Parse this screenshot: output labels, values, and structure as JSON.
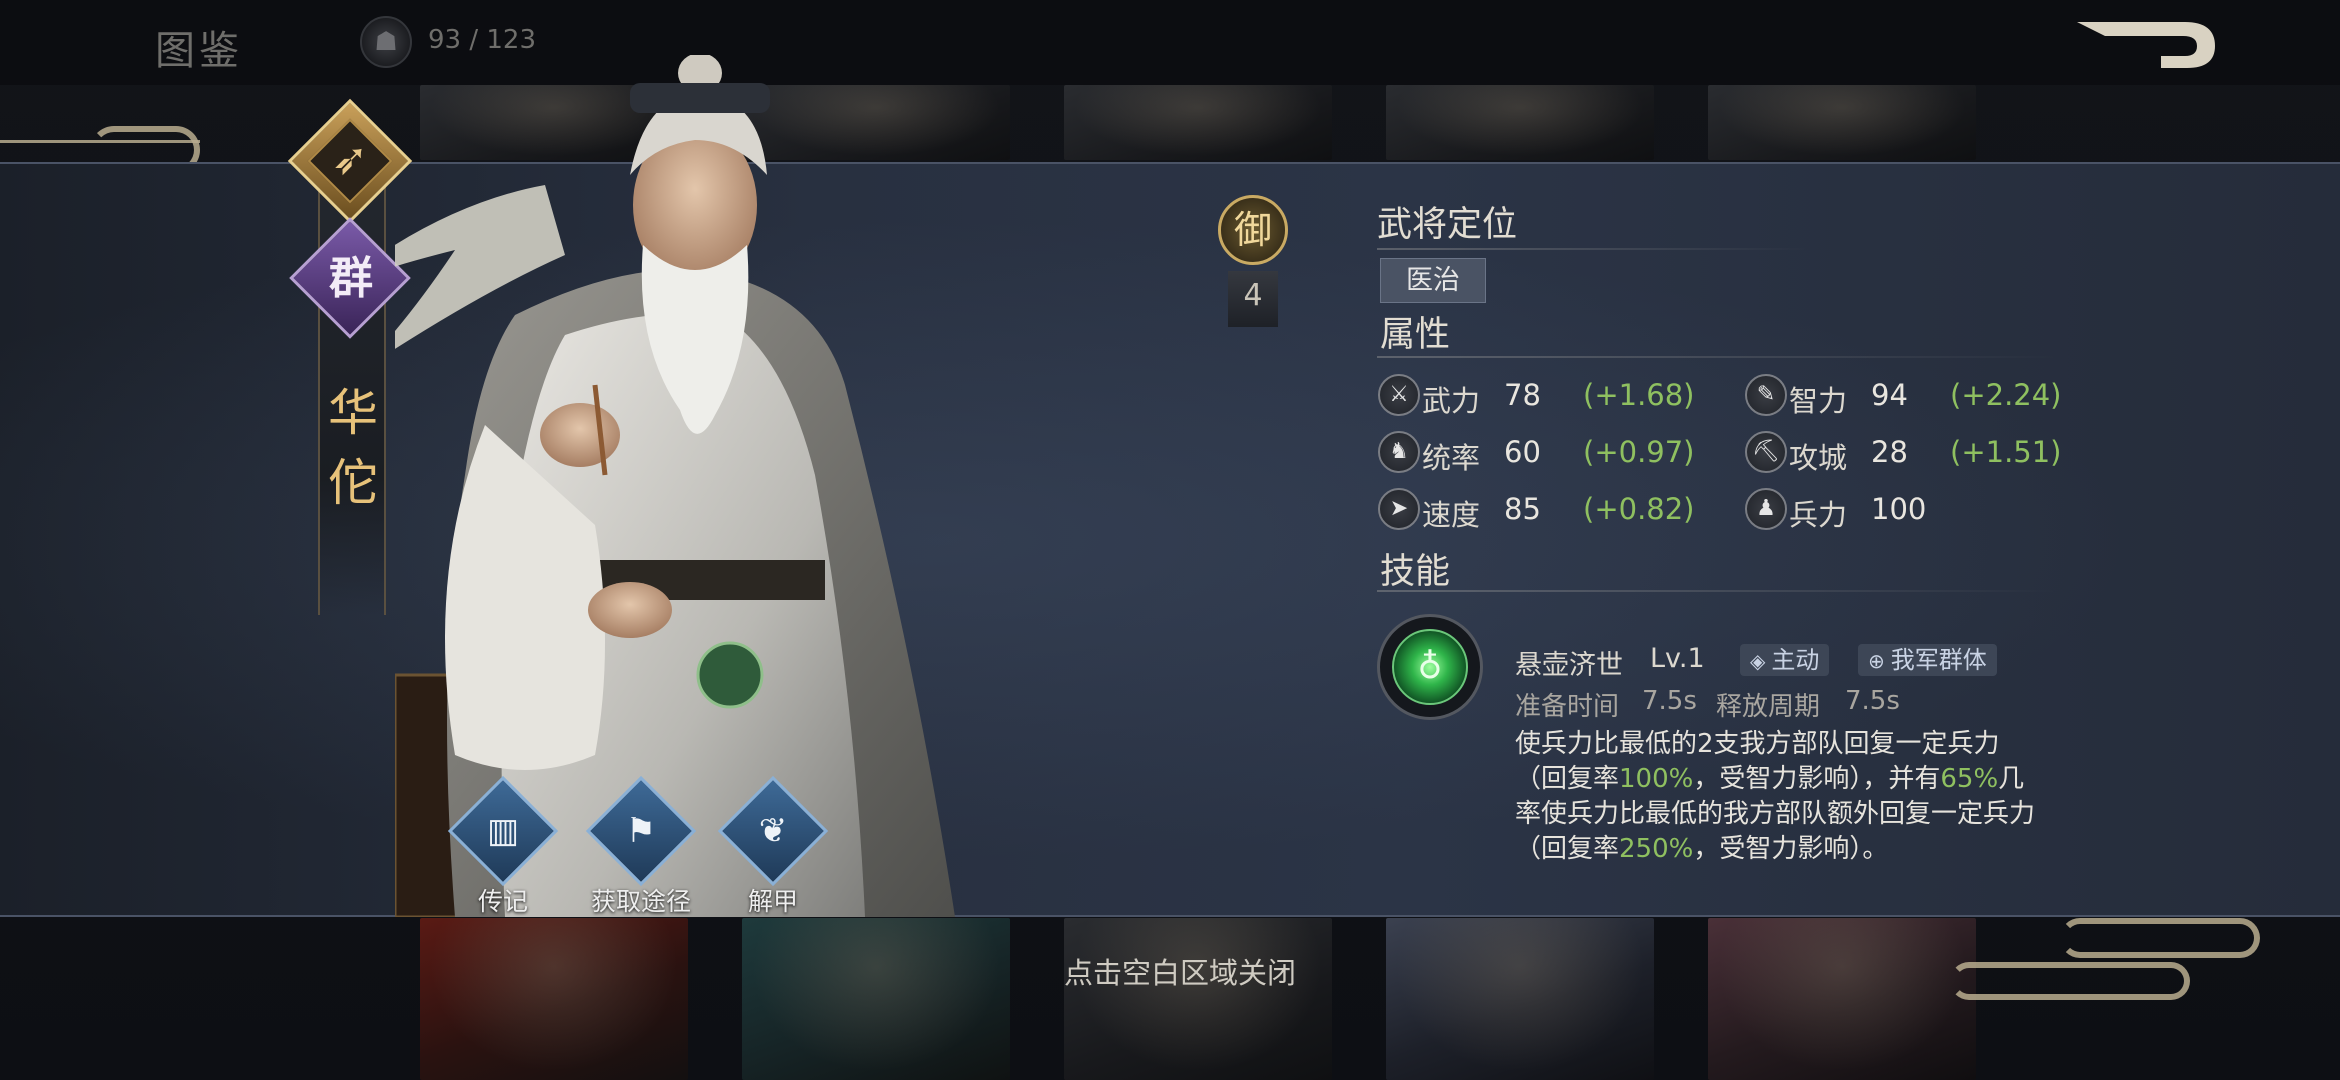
{
  "header": {
    "title": "图鉴",
    "counter": "93 / 123",
    "counter_icon": "general-helmet-icon"
  },
  "hero": {
    "class_icon": "bow-icon",
    "faction": "群",
    "name": "华佗",
    "defense_label": "御",
    "defense_value": "4"
  },
  "role": {
    "title": "武将定位",
    "tag": "医治"
  },
  "attributes": {
    "title": "属性",
    "stats": [
      {
        "name": "武力",
        "value": "78",
        "growth": "(+1.68)",
        "icon": "swords-icon"
      },
      {
        "name": "智力",
        "value": "94",
        "growth": "(+2.24)",
        "icon": "scroll-icon"
      },
      {
        "name": "统率",
        "value": "60",
        "growth": "(+0.97)",
        "icon": "horse-icon"
      },
      {
        "name": "攻城",
        "value": "28",
        "growth": "(+1.51)",
        "icon": "siege-icon"
      },
      {
        "name": "速度",
        "value": "85",
        "growth": "(+0.82)",
        "icon": "boot-icon"
      },
      {
        "name": "兵力",
        "value": "100",
        "growth": "",
        "icon": "troops-icon"
      }
    ]
  },
  "skills": {
    "title": "技能",
    "skill": {
      "icon": "gourd-icon",
      "name": "悬壶济世",
      "level": "Lv.1",
      "type_tag": "主动",
      "target_tag": "我军群体",
      "prep_label": "准备时间",
      "prep_value": "7.5s",
      "cycle_label": "释放周期",
      "cycle_value": "7.5s",
      "desc_1": "使兵力比最低的2支我方部队回复一定兵力（回复率",
      "desc_2": "100%",
      "desc_3": "，受智力影响），并有",
      "desc_4": "65%",
      "desc_5": "几率使兵力比最低的我方部队额外回复一定兵力（回复率",
      "desc_6": "250%",
      "desc_7": "，受智力影响）。"
    }
  },
  "actions": [
    {
      "label": "传记",
      "icon": "book-icon"
    },
    {
      "label": "获取途径",
      "icon": "map-icon"
    },
    {
      "label": "解甲",
      "icon": "leaf-icon"
    }
  ],
  "close_hint": "点击空白区域关闭",
  "colors": {
    "growth_green": "#8fc060",
    "gold": "#e7c27a",
    "faction_purple": "#7a5aa8",
    "panel_bg": "#283040"
  }
}
